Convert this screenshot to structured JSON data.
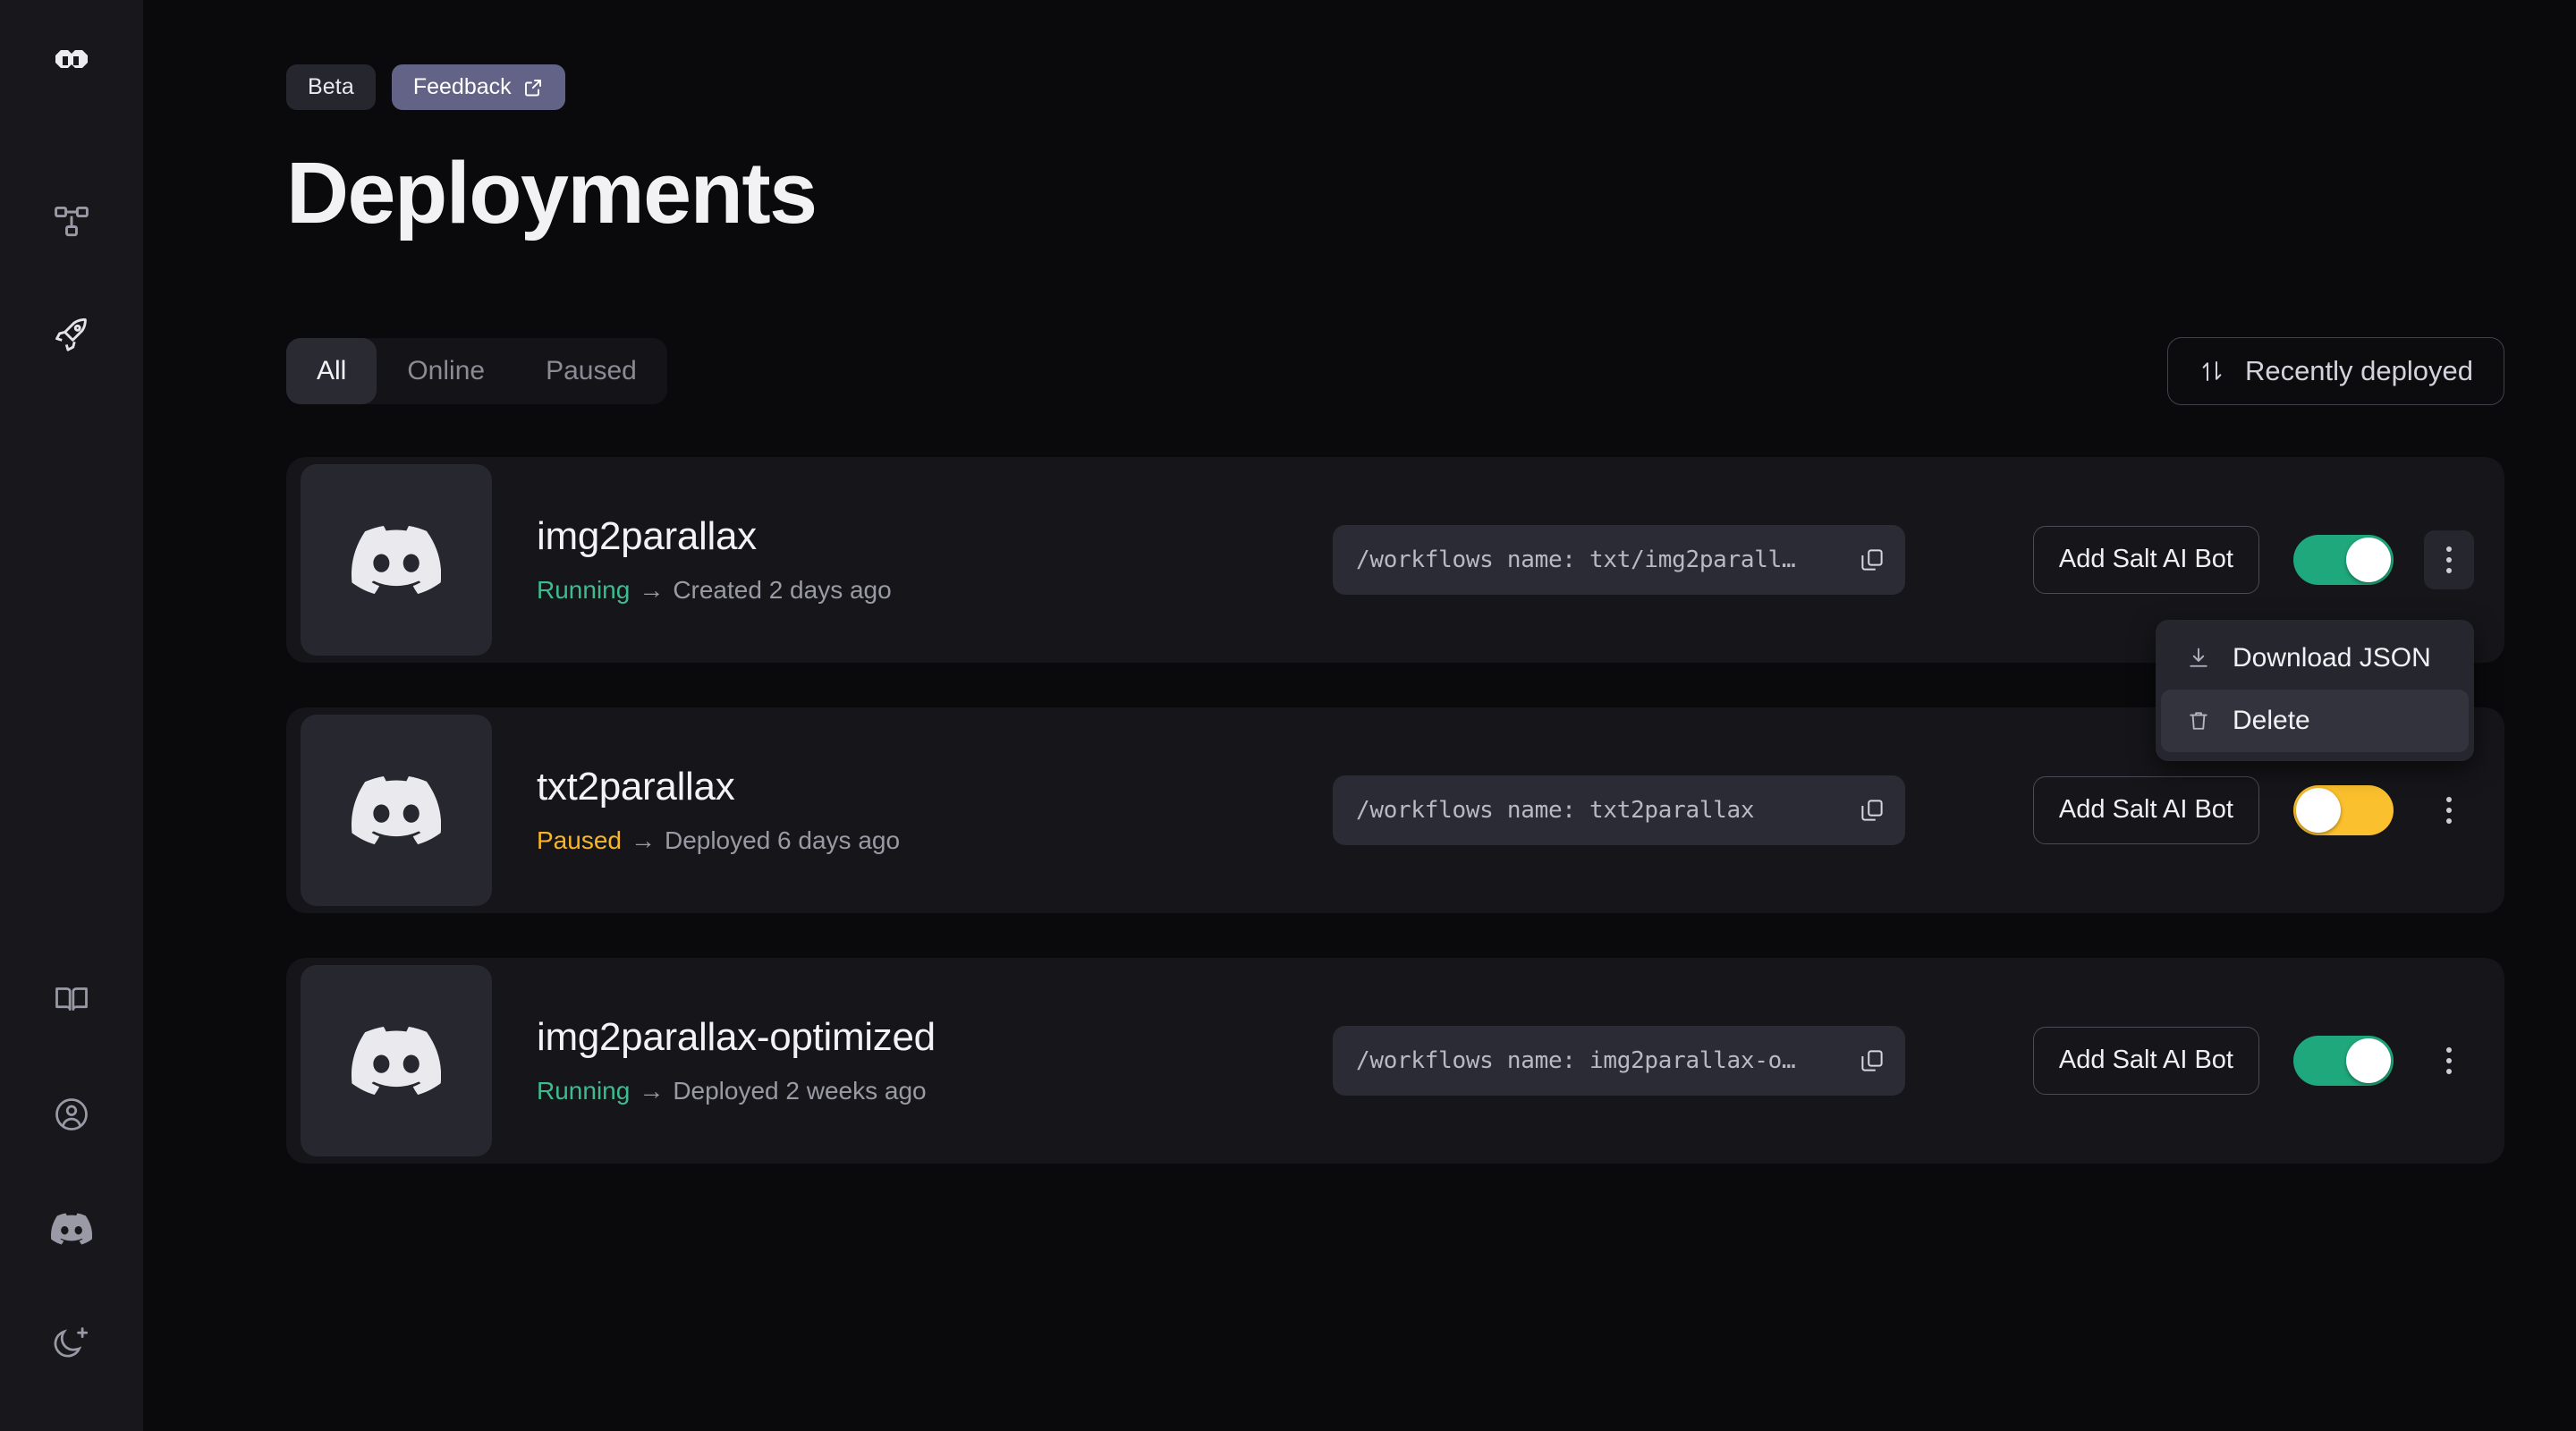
{
  "sidebar": {
    "logo": {
      "name": "infinity-logo"
    },
    "items": [
      {
        "name": "workflow-icon",
        "label": "Workflows"
      },
      {
        "name": "rocket-icon",
        "label": "Deployments"
      },
      {
        "name": "book-icon",
        "label": "Docs"
      },
      {
        "name": "user-icon",
        "label": "Account"
      },
      {
        "name": "discord-icon",
        "label": "Discord"
      },
      {
        "name": "moon-plus-icon",
        "label": "Theme"
      }
    ]
  },
  "header": {
    "beta_label": "Beta",
    "feedback_label": "Feedback",
    "title": "Deployments"
  },
  "toolbar": {
    "tabs": [
      {
        "label": "All",
        "active": true
      },
      {
        "label": "Online",
        "active": false
      },
      {
        "label": "Paused",
        "active": false
      }
    ],
    "sort_label": "Recently deployed",
    "sort_icon": "sort-arrows-icon"
  },
  "menu": {
    "items": [
      {
        "label": "Download JSON",
        "icon": "download-icon",
        "hovered": false
      },
      {
        "label": "Delete",
        "icon": "trash-icon",
        "hovered": true
      }
    ]
  },
  "deployments": [
    {
      "name": "img2parallax",
      "status": "Running",
      "status_color": "#3dbd8e",
      "arrow": "→",
      "meta": "Created 2 days ago",
      "path": "/workflows name: txt/img2parall…",
      "bot_label": "Add Salt AI Bot",
      "toggle_state": "on",
      "thumb_icon": "discord-icon"
    },
    {
      "name": "txt2parallax",
      "status": "Paused",
      "status_color": "#f7b529",
      "arrow": "→",
      "meta": "Deployed 6 days ago",
      "path": "/workflows name: txt2parallax",
      "bot_label": "Add Salt AI Bot",
      "toggle_state": "off",
      "thumb_icon": "discord-icon"
    },
    {
      "name": "img2parallax-optimized",
      "status": "Running",
      "status_color": "#3dbd8e",
      "arrow": "→",
      "meta": "Deployed 2 weeks ago",
      "path": "/workflows name: img2parallax-o…",
      "bot_label": "Add Salt AI Bot",
      "toggle_state": "on",
      "thumb_icon": "discord-icon"
    }
  ],
  "colors": {
    "app_bg": "#0a0a0c",
    "sidebar_bg": "#17171c",
    "card_bg": "#16161a",
    "accent_feedback": "#636387",
    "toggle_on": "#1fa87b",
    "toggle_off": "#fbc02d"
  }
}
